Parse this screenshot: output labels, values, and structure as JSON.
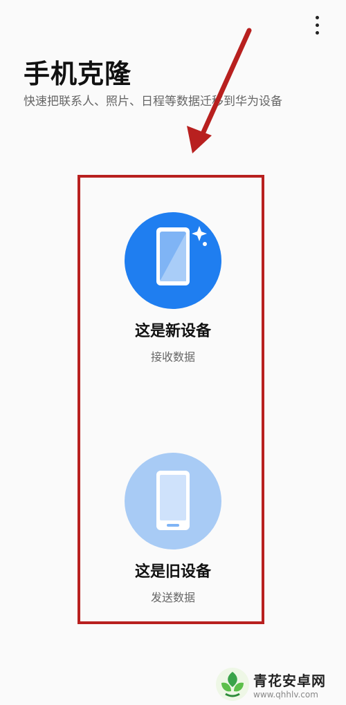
{
  "header": {
    "title": "手机克隆",
    "subtitle": "快速把联系人、照片、日程等数据迁移到华为设备",
    "more_icon": "more-vertical-icon"
  },
  "options": [
    {
      "title": "这是新设备",
      "subtitle": "接收数据",
      "icon": "phone-sparkle-icon",
      "circle_color": "#1f7ef0"
    },
    {
      "title": "这是旧设备",
      "subtitle": "发送数据",
      "icon": "phone-icon",
      "circle_color": "#a8cbf5"
    }
  ],
  "annotation": {
    "box_color": "#b8201f",
    "arrow_color": "#b8201f"
  },
  "watermark": {
    "name": "青花安卓网",
    "url": "www.qhhlv.com"
  }
}
